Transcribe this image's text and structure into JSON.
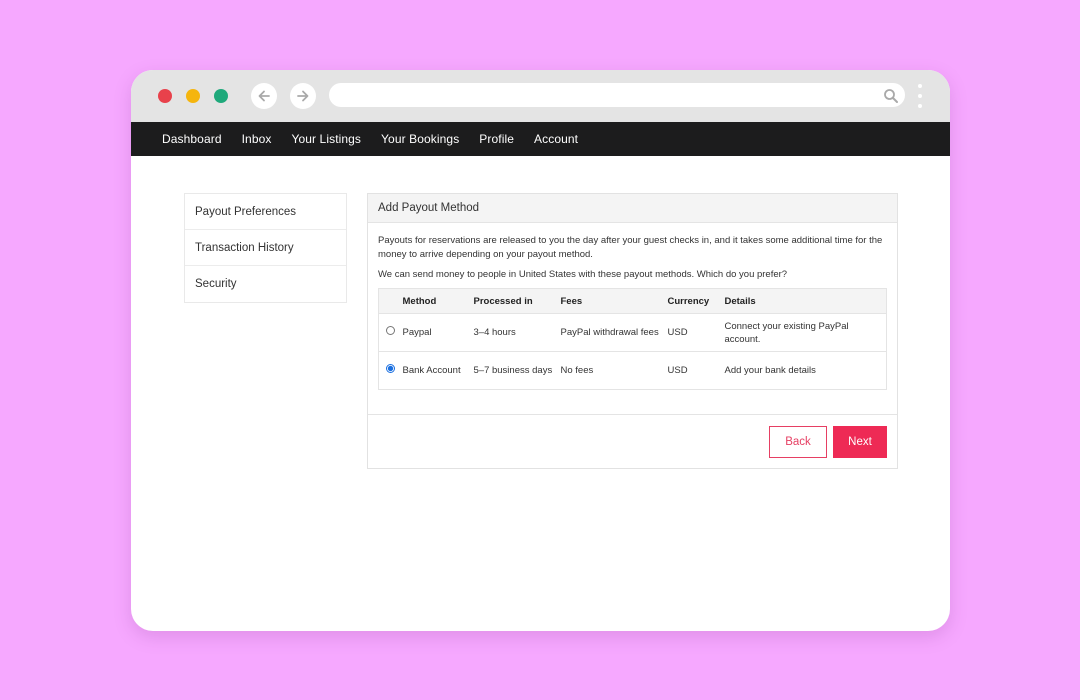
{
  "colors": {
    "background": "#f6a8ff",
    "nav_bar": "#1c1c1d",
    "accent": "#ee2a55",
    "traffic_red": "#e8414b",
    "traffic_yellow": "#f5b50e",
    "traffic_green": "#1fa97b"
  },
  "browser": {
    "address_value": "",
    "icons": [
      "arrow-left-icon",
      "arrow-right-icon",
      "search-icon",
      "kebab-menu-icon"
    ]
  },
  "nav": {
    "items": [
      "Dashboard",
      "Inbox",
      "Your Listings",
      "Your Bookings",
      "Profile",
      "Account"
    ]
  },
  "sidebar": {
    "items": [
      "Payout Preferences",
      "Transaction History",
      "Security"
    ]
  },
  "panel": {
    "title": "Add Payout Method",
    "intro": "Payouts for reservations are released to you the day after your guest checks in, and it takes some additional time for the money to arrive depending on your payout method.",
    "question": "We can send money to people in United States with these payout methods. Which do you prefer?",
    "table": {
      "headers": [
        "Method",
        "Processed in",
        "Fees",
        "Currency",
        "Details"
      ],
      "rows": [
        {
          "method": "Paypal",
          "processed": "3–4 hours",
          "fees": "PayPal withdrawal fees",
          "currency": "USD",
          "details": "Connect your existing PayPal account.",
          "selected": false
        },
        {
          "method": "Bank Account",
          "processed": "5–7 business days",
          "fees": "No fees",
          "currency": "USD",
          "details": "Add your bank details",
          "selected": true
        }
      ]
    },
    "back_label": "Back",
    "next_label": "Next"
  }
}
